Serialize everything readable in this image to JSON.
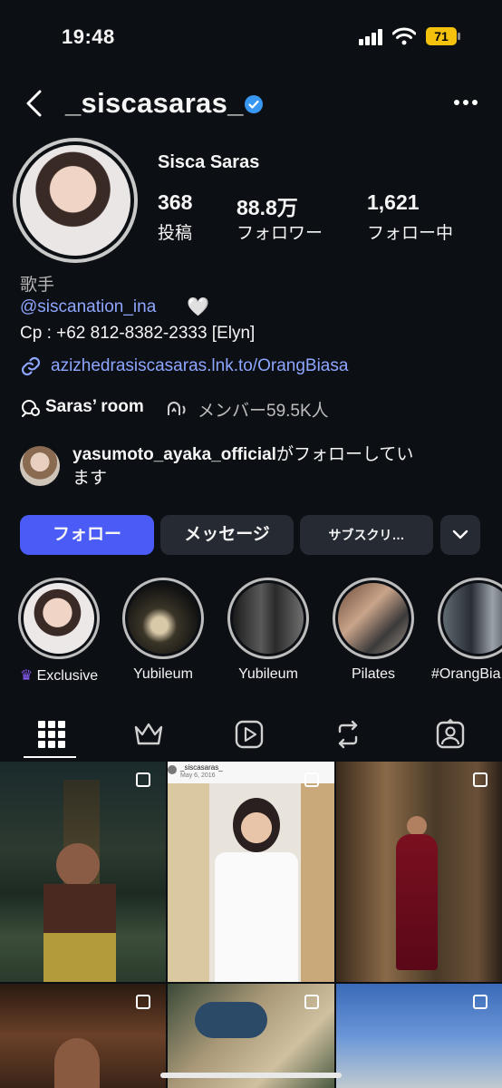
{
  "status_bar": {
    "time": "19:48",
    "battery": "71"
  },
  "header": {
    "username": "_siscasaras_"
  },
  "profile": {
    "name": "Sisca Saras",
    "stats": [
      {
        "value": "368",
        "label": "投稿"
      },
      {
        "value": "88.8万",
        "label": "フォロワー"
      },
      {
        "value": "1,621",
        "label": "フォロー中"
      }
    ]
  },
  "bio": {
    "category": "歌手",
    "mention": "@siscanation_ina",
    "heart": "🤍",
    "contact": "Cp : +62 812-8382-2333 [Elyn]",
    "link": "azizhedrasiscasaras.lnk.to/OrangBiasa"
  },
  "channel": {
    "name": "Saras’ room",
    "members": "メンバー59.5K人"
  },
  "followed_by": {
    "user": "yasumoto_ayaka_official",
    "suffix": "がフォローしてい",
    "suffix2": "ます"
  },
  "buttons": {
    "follow": "フォロー",
    "message": "メッセージ",
    "subscribe": "サブスクリ…"
  },
  "highlights": [
    {
      "label": "Exclusive",
      "crown": "♛"
    },
    {
      "label": "Yubileum"
    },
    {
      "label": "Yubileum"
    },
    {
      "label": "Pilates"
    },
    {
      "label": "#OrangBia"
    }
  ],
  "grid_caption": {
    "user": "_siscasaras_",
    "date": "May 6, 2016"
  },
  "colors": {
    "accent": "#4a5cf5",
    "background": "#0c0f14",
    "button": "#262a33",
    "link": "#8ea6ff"
  }
}
